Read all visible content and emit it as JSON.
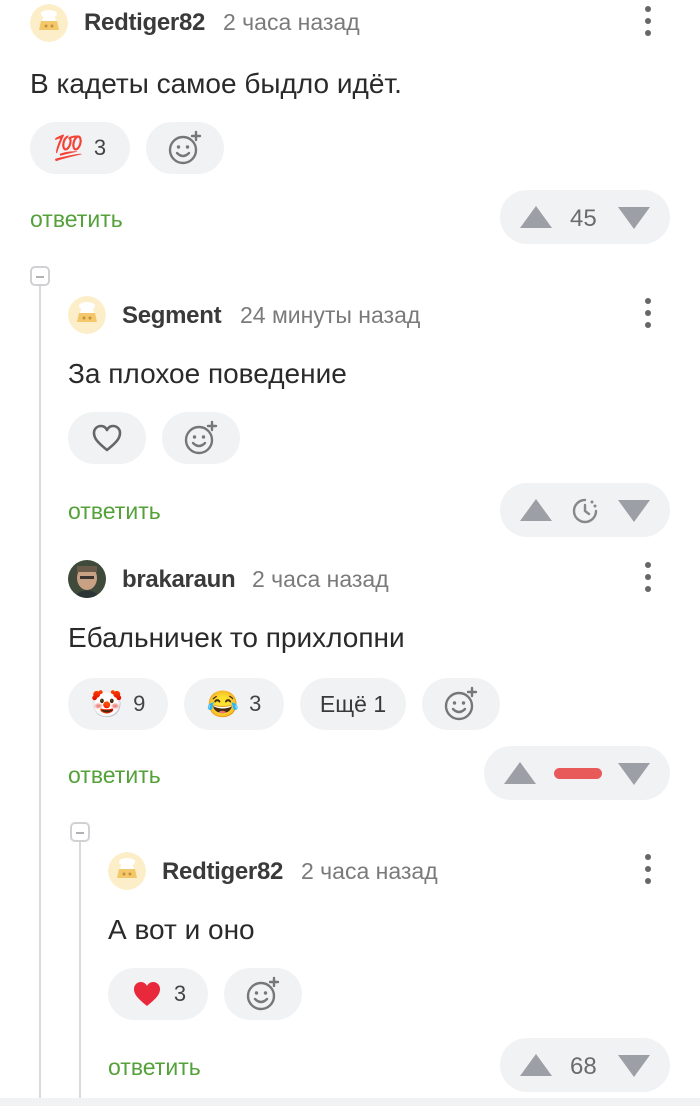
{
  "comments": [
    {
      "username": "Redtiger82",
      "time": "2 часа назад",
      "text": "В кадеты самое быдло идёт.",
      "reactions": [
        {
          "emoji": "💯",
          "count": "3"
        }
      ],
      "reply_label": "ответить",
      "score": "45"
    },
    {
      "username": "Segment",
      "time": "24 минуты назад",
      "text": "За плохое поведение",
      "reply_label": "ответить",
      "score_state": "pending"
    },
    {
      "username": "brakaraun",
      "time": "2 часа назад",
      "text": "Ебальничек то прихлопни",
      "reactions": [
        {
          "emoji": "🤡",
          "count": "9"
        },
        {
          "emoji": "😂",
          "count": "3"
        }
      ],
      "more_label": "Ещё 1",
      "reply_label": "ответить",
      "score_state": "negative"
    },
    {
      "username": "Redtiger82",
      "time": "2 часа назад",
      "text": "А вот и оно",
      "reactions": [
        {
          "emoji": "❤️",
          "count": "3"
        }
      ],
      "reply_label": "ответить",
      "score": "68"
    }
  ],
  "colors": {
    "reply": "#54a13a",
    "negative_bar": "#e85a5a",
    "pill_bg": "#f1f2f4",
    "heart": "#e8283b"
  },
  "icons": [
    "avatar-default",
    "more-vert-icon",
    "add-reaction-icon",
    "heart-outline-icon",
    "clock-icon",
    "upvote-icon",
    "downvote-icon",
    "collapse-icon"
  ]
}
